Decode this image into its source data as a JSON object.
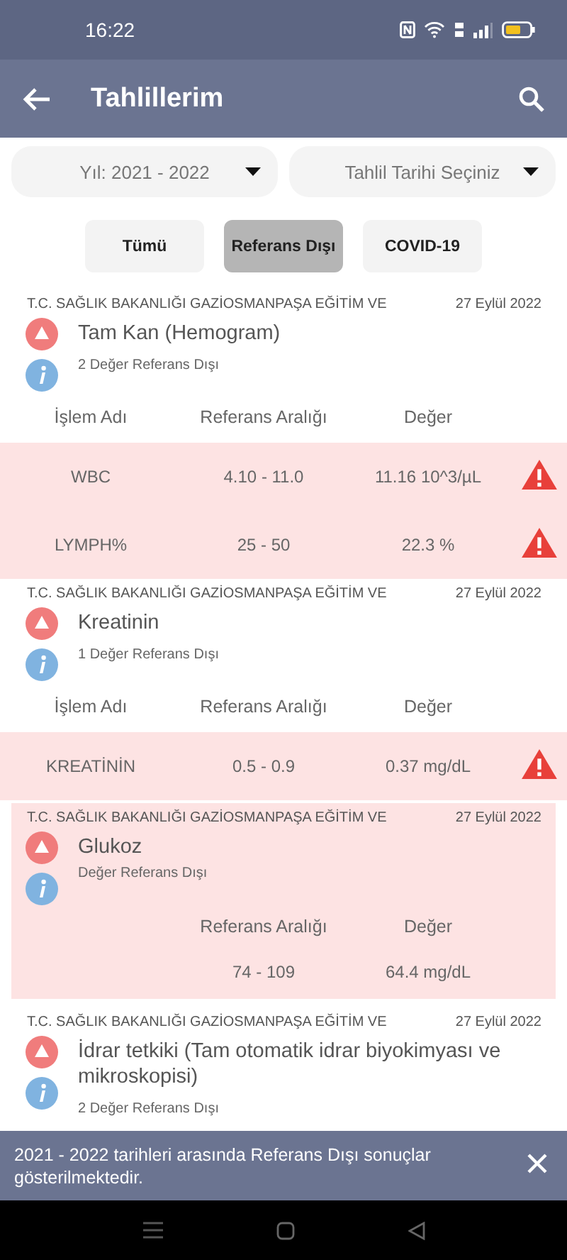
{
  "status_bar": {
    "time": "16:22"
  },
  "app_bar": {
    "title": "Tahlillerim"
  },
  "dropdowns": [
    {
      "value": "Yıl: 2021 - 2022"
    },
    {
      "value": "Tahlil Tarihi Seçiniz"
    }
  ],
  "filters": [
    {
      "label": "Tümü",
      "selected": false
    },
    {
      "label": "Referans Dışı",
      "selected": true
    },
    {
      "label": "COVID-19",
      "selected": false
    }
  ],
  "results": [
    {
      "hospital": "T.C. SAĞLIK BAKANLIĞI GAZİOSMANPAŞA EĞİTİM VE",
      "date": "27 Eylül 2022",
      "title": "Tam Kan (Hemogram)",
      "summary": "2 Değer Referans Dışı",
      "highlighted": false,
      "columns": {
        "name": "İşlem Adı",
        "range": "Referans Aralığı",
        "value": "Değer"
      },
      "rows": [
        {
          "name": "WBC",
          "range": "4.10 - 11.0",
          "value": "11.16 10^3/µL",
          "alert": true
        },
        {
          "name": "LYMPH%",
          "range": "25 - 50",
          "value": "22.3 %",
          "alert": true
        }
      ]
    },
    {
      "hospital": "T.C. SAĞLIK BAKANLIĞI GAZİOSMANPAŞA EĞİTİM VE",
      "date": "27 Eylül 2022",
      "title": "Kreatinin",
      "summary": "1 Değer Referans Dışı",
      "highlighted": false,
      "columns": {
        "name": "İşlem Adı",
        "range": "Referans Aralığı",
        "value": "Değer"
      },
      "rows": [
        {
          "name": "KREATİNİN",
          "range": "0.5 - 0.9",
          "value": "0.37 mg/dL",
          "alert": true
        }
      ]
    },
    {
      "hospital": "T.C. SAĞLIK BAKANLIĞI GAZİOSMANPAŞA EĞİTİM VE",
      "date": "27 Eylül 2022",
      "title": "Glukoz",
      "summary": "Değer Referans Dışı",
      "highlighted": true,
      "columns": {
        "range": "Referans Aralığı",
        "value": "Değer"
      },
      "rows": [
        {
          "range": "74 - 109",
          "value": "64.4 mg/dL",
          "alert": false
        }
      ]
    },
    {
      "hospital": "T.C. SAĞLIK BAKANLIĞI GAZİOSMANPAŞA EĞİTİM VE",
      "date": "27 Eylül 2022",
      "title": "İdrar tetkiki (Tam otomatik idrar biyokimyası ve mikroskopisi)",
      "summary": "2 Değer Referans Dışı",
      "highlighted": false
    }
  ],
  "snackbar": {
    "message": "2021 - 2022 tarihleri arasında Referans Dışı sonuçlar gösterilmektedir."
  }
}
